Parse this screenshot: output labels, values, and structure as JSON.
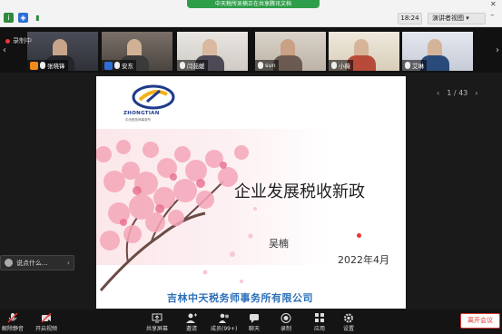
{
  "top": {
    "share_banner": "中天税所吴楠正在共享腾讯文档",
    "clock": "18:24",
    "view_mode": "演讲者视图"
  },
  "recording": {
    "label": "录制中"
  },
  "participants": [
    {
      "name": "张晓锋",
      "badge": "orange"
    },
    {
      "name": "安东",
      "badge": "blue"
    },
    {
      "name": "闫茹媛",
      "badge": "none"
    },
    {
      "name": "sun",
      "badge": "none"
    },
    {
      "name": "小薇",
      "badge": "none"
    },
    {
      "name": "艾琳",
      "badge": "none"
    }
  ],
  "slide": {
    "logo_brand": "ZHONGTIAN",
    "logo_sub": "中天税务师事务所",
    "title": "企业发展税收新政",
    "author": "吴楠",
    "date": "2022年4月",
    "company": "吉林中天税务师事务所有限公司"
  },
  "pager": {
    "text": "1 / 43"
  },
  "chat": {
    "placeholder": "说点什么..."
  },
  "toolbar": {
    "mute": "解除静音",
    "video": "开启视频",
    "share": "共享屏幕",
    "invite": "邀请",
    "members": "成员(99+)",
    "chat": "聊天",
    "record": "录制",
    "apps": "应用",
    "settings": "设置",
    "leave": "离开会议"
  },
  "colors": {
    "leave": "#dd3333",
    "share_banner": "#2f9e4a",
    "company_text": "#2b6fb8"
  }
}
